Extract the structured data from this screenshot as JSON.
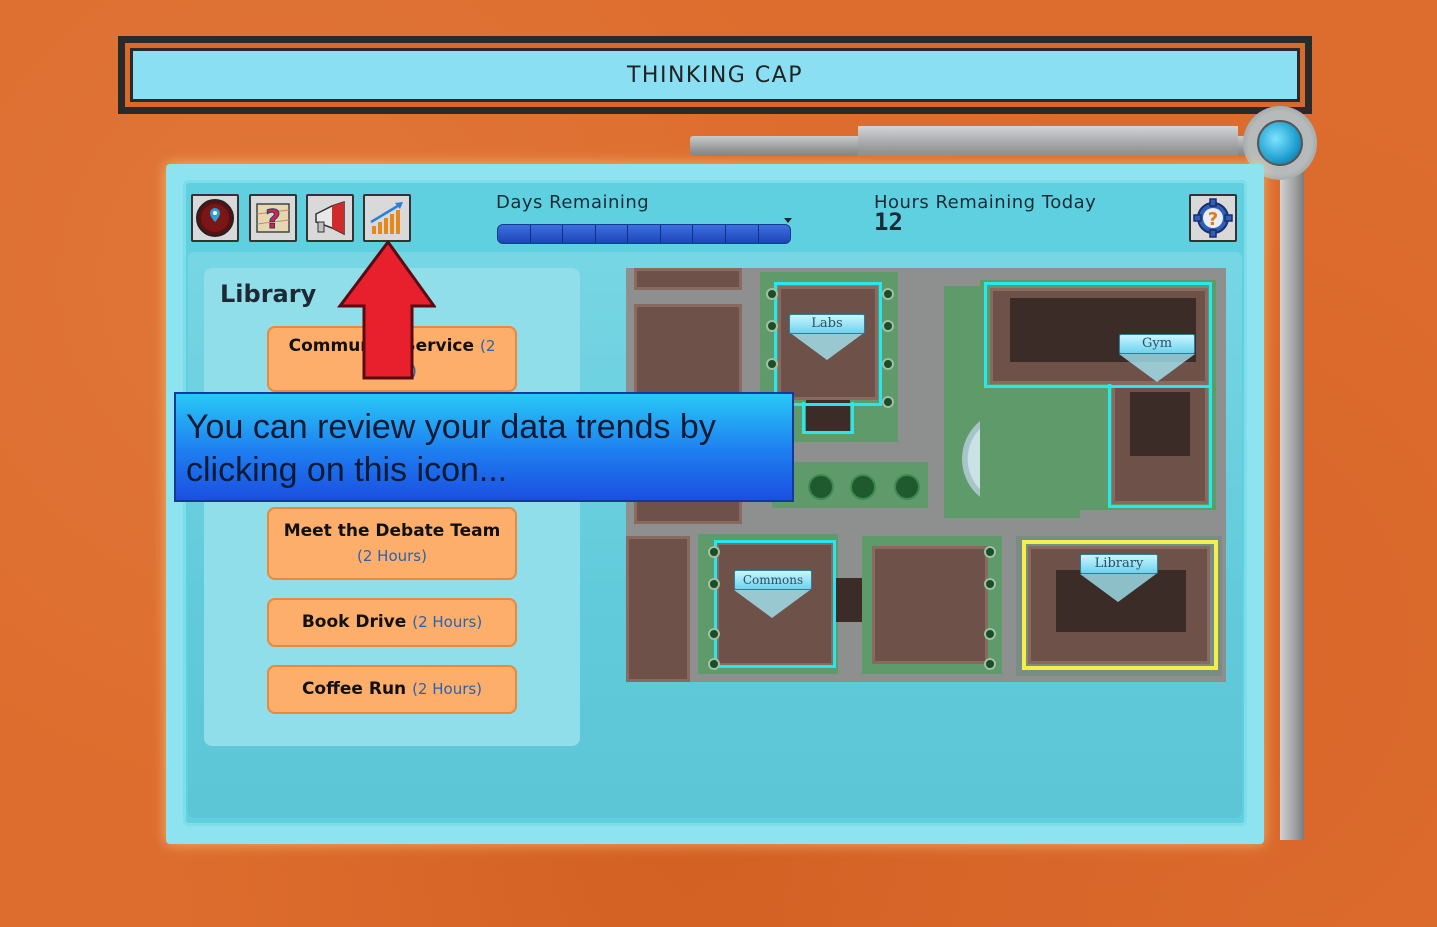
{
  "title": "THINKING CAP",
  "toolbar": {
    "icons": [
      "map-pin-icon",
      "help-map-icon",
      "megaphone-icon",
      "data-trends-icon"
    ]
  },
  "days": {
    "label": "Days Remaining",
    "segments": 9,
    "progress": 1.0
  },
  "hours": {
    "label": "Hours Remaining Today",
    "value": "12"
  },
  "location": {
    "name": "Library",
    "activities": [
      {
        "name": "Community Service",
        "hours": "(2 Hours)"
      },
      {
        "name": "Meet the Debate Team",
        "hours": "(2 Hours)"
      },
      {
        "name": "Book Drive",
        "hours": "(2 Hours)"
      },
      {
        "name": "Coffee Run",
        "hours": "(2 Hours)"
      }
    ]
  },
  "map": {
    "tags": {
      "labs": "Labs",
      "gym": "Gym",
      "commons": "Commons",
      "library": "Library"
    },
    "selected": "Library"
  },
  "tooltip": "You can review your data trends by clicking on this icon...",
  "colors": {
    "background": "#dd6d2e",
    "panel": "#5fd0df",
    "activity": "#fcae6a",
    "tooltip": "#1e7df0"
  }
}
